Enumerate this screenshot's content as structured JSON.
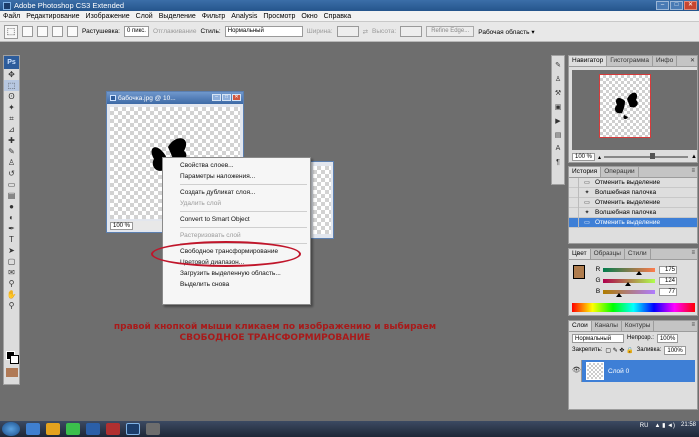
{
  "titlebar": {
    "title": "Adobe Photoshop CS3 Extended"
  },
  "menu": [
    "Файл",
    "Редактирование",
    "Изображение",
    "Слой",
    "Выделение",
    "Фильтр",
    "Analysis",
    "Просмотр",
    "Окно",
    "Справка"
  ],
  "options": {
    "feather_label": "Растушевка:",
    "feather_value": "0 пикс.",
    "antialias_label": "Отглаживание",
    "style_label": "Стиль:",
    "style_value": "Нормальный",
    "width_label": "Ширина:",
    "height_label": "Высота:",
    "refine_edge": "Refine Edge...",
    "workspace": "Рабочая область ▾"
  },
  "document": {
    "title": "бабочка.jpg @ 10...",
    "zoom": "100 %"
  },
  "context_menu": {
    "items": [
      {
        "label": "Свойства слоев...",
        "disabled": false
      },
      {
        "label": "Параметры наложения...",
        "disabled": false
      },
      {
        "label": "Создать дубликат слоя...",
        "disabled": false
      },
      {
        "label": "Удалить слой",
        "disabled": true
      },
      {
        "label": "Convert to Smart Object",
        "disabled": false
      },
      {
        "label": "Растеризовать слой",
        "disabled": true
      },
      {
        "label": "Свободное трансформирование",
        "disabled": false
      },
      {
        "label": "Цветовой диапазон...",
        "disabled": false
      },
      {
        "label": "Загрузить выделенную область...",
        "disabled": false
      },
      {
        "label": "Выделить снова",
        "disabled": false
      }
    ]
  },
  "caption": {
    "line1": "правой кнопкой мыши кликаем по изображению и выбираем",
    "line2": "СВОБОДНОЕ ТРАНСФОРМИРОВАНИЕ"
  },
  "navigator": {
    "tabs": [
      "Навигатор",
      "Гистограмма",
      "Инфо"
    ],
    "zoom": "100 %"
  },
  "history": {
    "tabs": [
      "История",
      "Операции"
    ],
    "items": [
      {
        "label": "Отменить выделение",
        "selected": false
      },
      {
        "label": "Волшебная палочка",
        "selected": false
      },
      {
        "label": "Отменить выделение",
        "selected": false
      },
      {
        "label": "Волшебная палочка",
        "selected": false
      },
      {
        "label": "Отменить выделение",
        "selected": true
      }
    ]
  },
  "color": {
    "tabs": [
      "Цвет",
      "Образцы",
      "Стили"
    ],
    "swatch": "#af7c4d",
    "channels": [
      {
        "label": "R",
        "value": "175",
        "fraction": 0.69
      },
      {
        "label": "G",
        "value": "124",
        "fraction": 0.49
      },
      {
        "label": "B",
        "value": "77",
        "fraction": 0.3
      }
    ]
  },
  "layers": {
    "tabs": [
      "Слои",
      "Каналы",
      "Контуры"
    ],
    "blend": "Нормальный",
    "opacity_label": "Непрозр.:",
    "opacity": "100%",
    "lock_label": "Закрепить:",
    "fill_label": "Заливка:",
    "fill": "100%",
    "layer_name": "Слой 0"
  },
  "taskbar": {
    "lang": "RU",
    "time": "21:58"
  }
}
